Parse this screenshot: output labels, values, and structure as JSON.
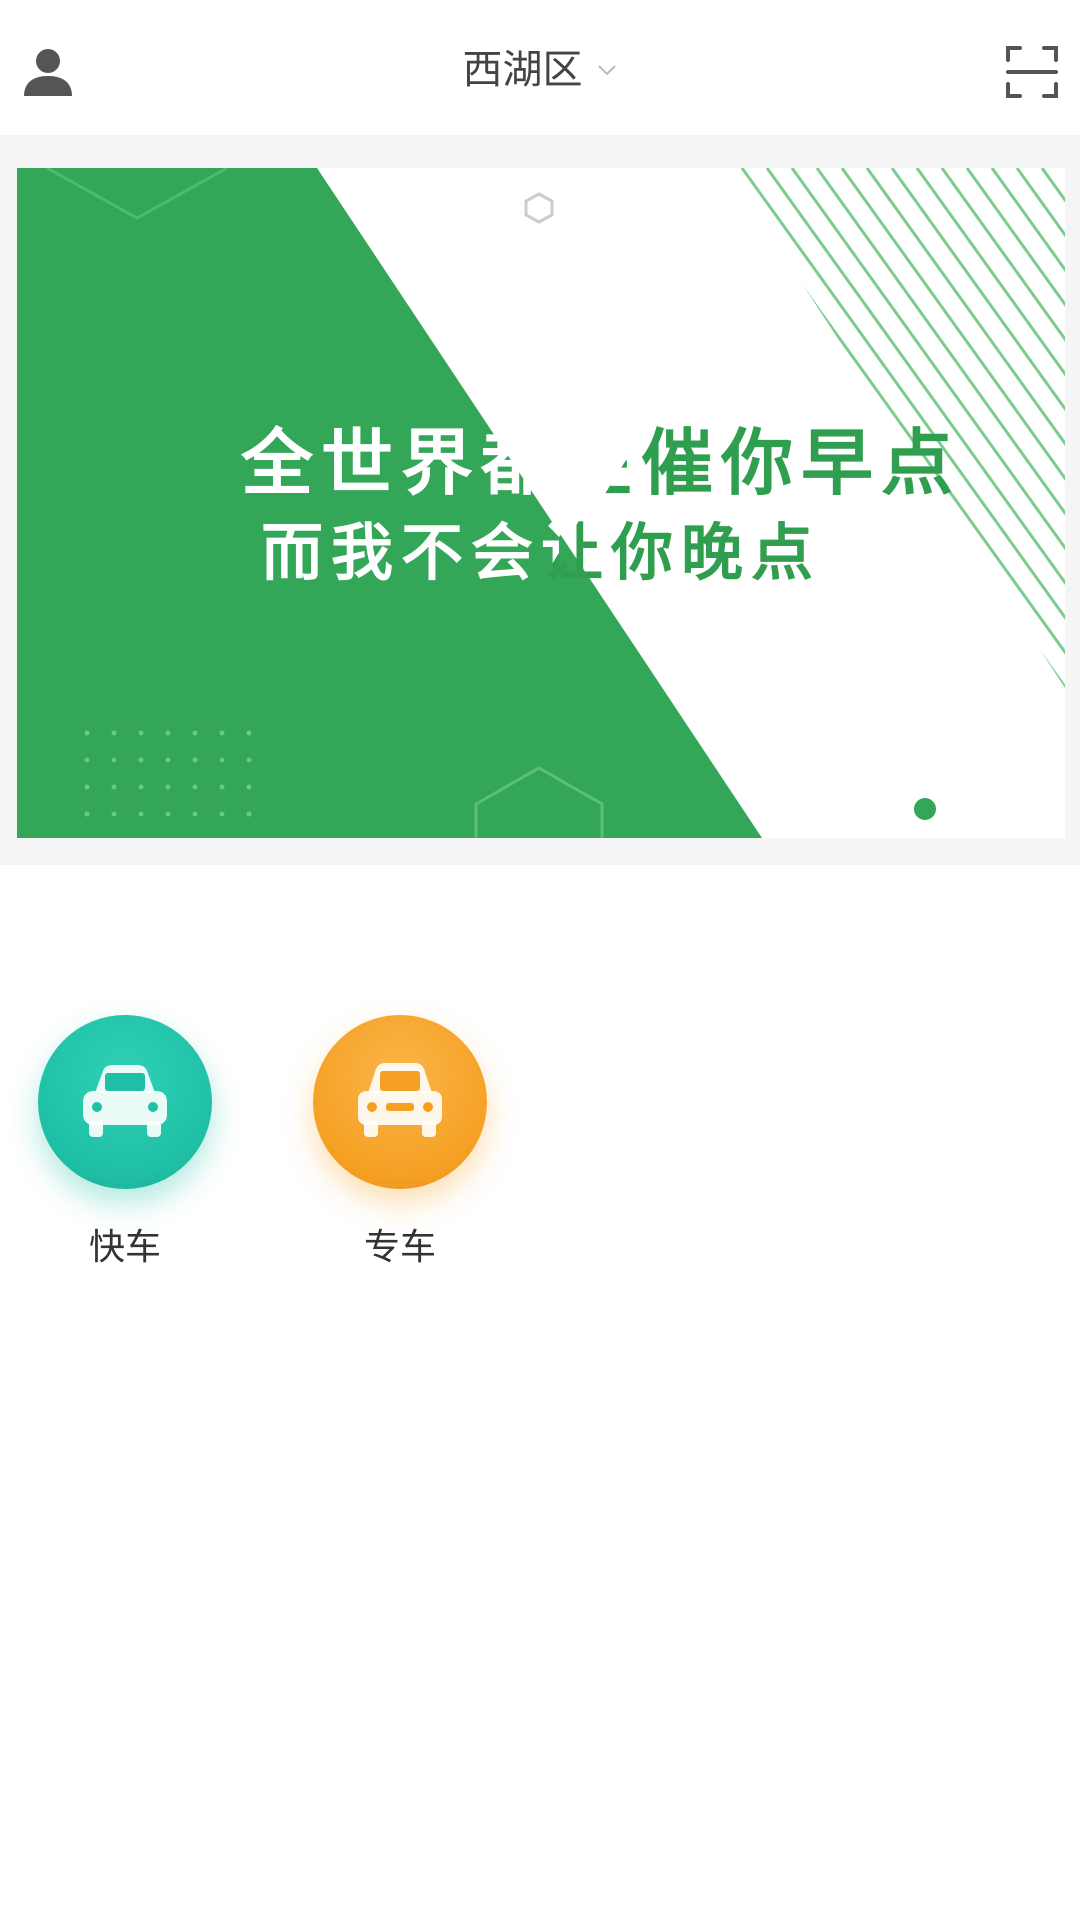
{
  "header": {
    "location": "西湖区",
    "icons": {
      "user": "user-icon",
      "chevron": "chevron-down-icon",
      "scan": "scan-icon"
    }
  },
  "banner": {
    "line1": "全世界都在催你早点",
    "line2": "而我不会让你晚点",
    "colors": {
      "green": "#33a657",
      "white": "#ffffff"
    },
    "carousel": {
      "active_index": 1,
      "count": 1
    }
  },
  "services": [
    {
      "label": "快车",
      "icon": "car-icon",
      "color": "#1fbfa5"
    },
    {
      "label": "专车",
      "icon": "car-icon",
      "color": "#f5a023"
    }
  ]
}
